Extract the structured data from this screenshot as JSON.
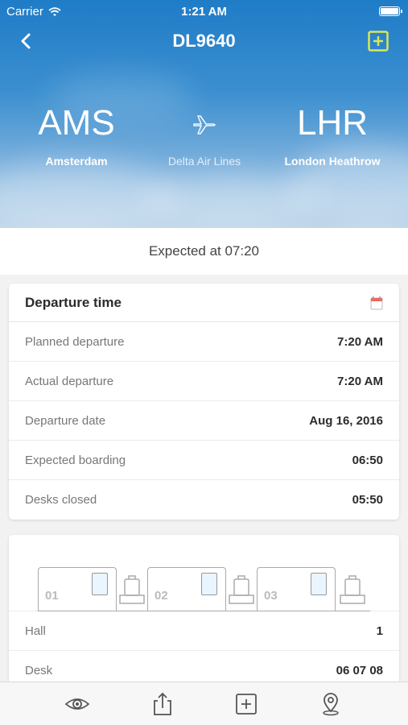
{
  "status_bar": {
    "carrier": "Carrier",
    "time": "1:21 AM"
  },
  "header": {
    "flight_number": "DL9640"
  },
  "route": {
    "origin_code": "AMS",
    "origin_city": "Amsterdam",
    "airline": "Delta Air Lines",
    "destination_code": "LHR",
    "destination_city": "London Heathrow"
  },
  "expected_text": "Expected at 07:20",
  "departure_card": {
    "title": "Departure time",
    "rows": [
      {
        "label": "Planned departure",
        "value": "7:20 AM"
      },
      {
        "label": "Actual departure",
        "value": "7:20 AM"
      },
      {
        "label": "Departure date",
        "value": "Aug 16, 2016"
      },
      {
        "label": "Expected boarding",
        "value": "06:50"
      },
      {
        "label": "Desks closed",
        "value": "05:50"
      }
    ]
  },
  "checkin_card": {
    "desk_labels": [
      "01",
      "02",
      "03"
    ],
    "rows": [
      {
        "label": "Hall",
        "value": "1"
      },
      {
        "label": "Desk",
        "value": "06 07 08"
      }
    ]
  },
  "tabbar": {
    "icons": [
      "eye-icon",
      "share-icon",
      "add-icon",
      "location-pin-icon"
    ]
  },
  "colors": {
    "accent_yellow": "#d8e65a",
    "sky_blue": "#2a82cb"
  }
}
